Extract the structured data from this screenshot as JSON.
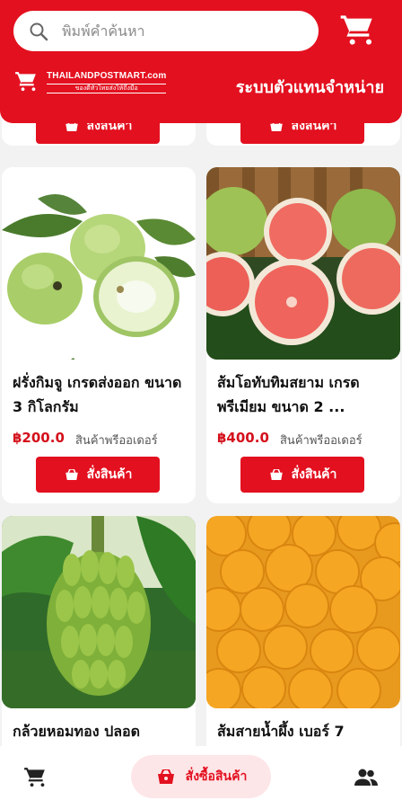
{
  "search": {
    "placeholder": "พิมพ์คำค้นหา"
  },
  "brand": {
    "name": "THAILANDPOSTMART.com",
    "tagline": "ของดีทั่วไทยส่งให้ถึงมือ"
  },
  "header": {
    "agent_title": "ระบบตัวแทนจำหน่าย"
  },
  "order_button_label": "สั่งสินค้า",
  "products": [
    {
      "name": "",
      "price": "",
      "status": ""
    },
    {
      "name": "",
      "price": "",
      "status": ""
    },
    {
      "name": "ฝรั่งกิมจู เกรดส่งออก ขนาด 3 กิโลกรัม",
      "price": "฿200.0",
      "status": "สินค้าพรีออเดอร์"
    },
    {
      "name": "ส้มโอทับทิมสยาม เกรดพรีเมียม ขนาด 2 ...",
      "price": "฿400.0",
      "status": "สินค้าพรีออเดอร์"
    },
    {
      "name": "กล้วยหอมทอง ปลอด",
      "price": "",
      "status": ""
    },
    {
      "name": "ส้มสายน้ำผึ้ง เบอร์ 7",
      "price": "",
      "status": ""
    }
  ],
  "bottom_nav": {
    "order_label": "สั่งซื้อสินค้า"
  },
  "icons": {
    "search": "search-icon",
    "cart": "cart-icon",
    "basket": "basket-icon",
    "people": "people-icon"
  },
  "colors": {
    "brand_red": "#e3101f",
    "price_red": "#d4101c",
    "nav_pill": "#fde6e8"
  }
}
